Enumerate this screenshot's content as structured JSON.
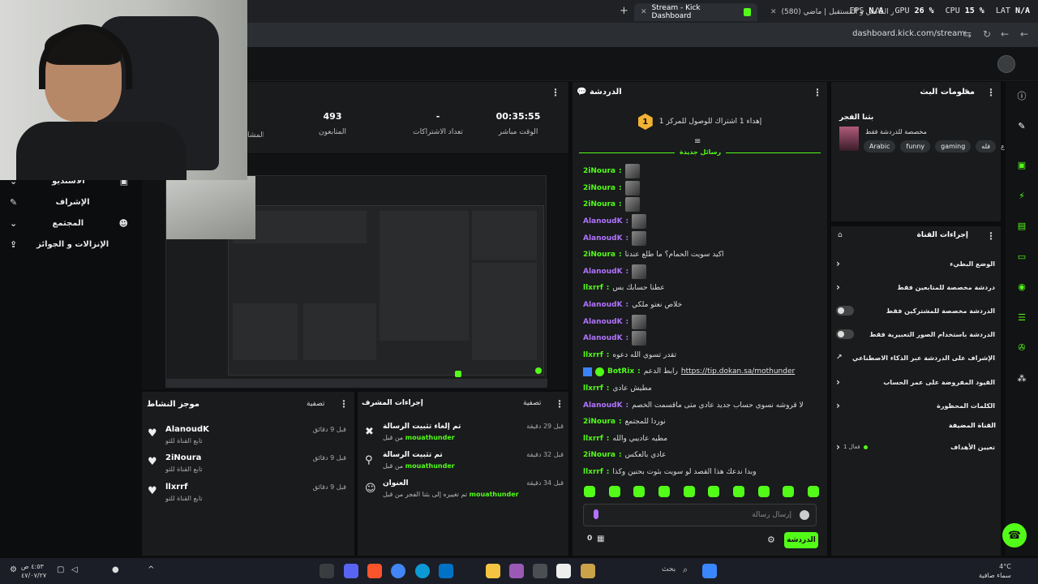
{
  "browser": {
    "tabs": [
      {
        "label": "Stream - Kick Dashboard",
        "active": true
      },
      {
        "label": "(580) ناور الماضي و المستقبل | ماضي",
        "active": false
      }
    ],
    "url": "dashboard.kick.com/stream",
    "perf": {
      "fps_label": "FPS",
      "fps": "N/A",
      "gpu_label": "GPU",
      "gpu": "26 %",
      "cpu_label": "CPU",
      "cpu": "15 %",
      "lat_label": "LAT",
      "lat": "N/A"
    }
  },
  "left_nav": [
    {
      "label": "الاستديو",
      "icon": "studio-icon"
    },
    {
      "label": "الإشراف",
      "icon": "wrench-icon"
    },
    {
      "label": "المجتمع",
      "icon": "community-icon"
    },
    {
      "label": "الإنزالات و الجوائز",
      "icon": "drops-icon"
    }
  ],
  "stats": {
    "live_time": {
      "value": "00:35:55",
      "label": "الوقت مباشر"
    },
    "subs": {
      "value": "-",
      "label": "تعداد الاشتراكات"
    },
    "viewers": {
      "value": "493",
      "label": "المتابعون"
    },
    "partial_label": "المشا"
  },
  "activity": {
    "title": "موجز النشاط",
    "filter": "تصفية",
    "items": [
      {
        "name": "AlanoudK",
        "sub": "تابع القناة للتو",
        "time": "قبل 9 دقائق"
      },
      {
        "name": "2iNoura",
        "sub": "تابع القناة للتو",
        "time": "قبل 9 دقائق"
      },
      {
        "name": "llxrrf",
        "sub": "تابع القناة للتو",
        "time": "قبل 9 دقائق"
      }
    ]
  },
  "mod_actions": {
    "title": "إجراءات المشرف",
    "filter": "تصفية",
    "items": [
      {
        "title": "تم إلغاء تثبيت الرسالة",
        "by_prefix": "من قبل",
        "user": "mouathunder",
        "time": "قبل 29 دقيقة"
      },
      {
        "title": "تم تثبيت الرسالة",
        "by_prefix": "من قبل",
        "user": "mouathunder",
        "time": "قبل 32 دقيقة"
      },
      {
        "title": "العنوان",
        "by_prefix": "تم تغييره إلى بثنا الفجر من قبل",
        "user": "mouathunder",
        "time": "قبل 34 دقيقة"
      }
    ]
  },
  "chat": {
    "title": "الدردشة",
    "goal_text": "إهداء 1 اشتراك للوصول للمركز 1",
    "goal_rank": "1",
    "new_messages": "رسائل جديدة",
    "colors": {
      "green": "#53fc18",
      "purple": "#b072ff"
    },
    "messages": [
      {
        "user": "2iNoura",
        "color": "#53fc18",
        "text": "",
        "emotes": 1
      },
      {
        "user": "2iNoura",
        "color": "#53fc18",
        "text": "",
        "emotes": 1
      },
      {
        "user": "2iNoura",
        "color": "#53fc18",
        "text": "",
        "emotes": 1
      },
      {
        "user": "AlanoudK",
        "color": "#b072ff",
        "text": "",
        "emotes": 1
      },
      {
        "user": "AlanoudK",
        "color": "#b072ff",
        "text": "",
        "emotes": 1
      },
      {
        "user": "2iNoura",
        "color": "#53fc18",
        "text": "اكيد سويت الحمام؟ ما طلع عندنا",
        "emotes": 0
      },
      {
        "user": "AlanoudK",
        "color": "#b072ff",
        "text": "",
        "emotes": 1
      },
      {
        "user": "llxrrf",
        "color": "#53fc18",
        "text": "عطنا حسابك بس",
        "emotes": 0
      },
      {
        "user": "AlanoudK",
        "color": "#b072ff",
        "text": "خلاص نعتو ملكي",
        "emotes": 0
      },
      {
        "user": "AlanoudK",
        "color": "#b072ff",
        "text": "",
        "emotes": 1
      },
      {
        "user": "AlanoudK",
        "color": "#b072ff",
        "text": "",
        "emotes": 1
      },
      {
        "user": "llxrrf",
        "color": "#53fc18",
        "text": "تقدر تسوي الله دعوه",
        "emotes": 0
      },
      {
        "user": "BotRix",
        "color": "#53fc18",
        "text": "رابط الدعم",
        "link": "https://tip.dokan.sa/mothunder",
        "bot": true
      },
      {
        "user": "llxrrf",
        "color": "#53fc18",
        "text": "مطيش عادي",
        "emotes": 0
      },
      {
        "user": "AlanoudK",
        "color": "#b072ff",
        "text": "لا قروشه نسوي حساب جديد عادي متى ماقسمت الخصم",
        "emotes": 0
      },
      {
        "user": "2iNoura",
        "color": "#53fc18",
        "text": "نوردا للمجتمع",
        "emotes": 0
      },
      {
        "user": "llxrrf",
        "color": "#53fc18",
        "text": "مطيه عاديبي والله",
        "emotes": 0
      },
      {
        "user": "2iNoura",
        "color": "#53fc18",
        "text": "عادي بالعكس",
        "emotes": 0
      },
      {
        "user": "llxrrf",
        "color": "#53fc18",
        "text": "وبدا ندعك هذا القصد لو سويت بثوت بحنين وكذا",
        "emotes": 0
      }
    ],
    "input_placeholder": "إرسال رسالة",
    "send_button": "الدردشة",
    "count": "0"
  },
  "stream_info": {
    "title": "معلومات البث",
    "stream_name": "بثنا الفجر",
    "category": "مخصصة للدردشة فقط",
    "tags": [
      "Arabic",
      "funny",
      "gaming",
      "فله"
    ],
    "extra_tag": "ع"
  },
  "channel_actions": {
    "title": "إجراءات القناة",
    "rows": [
      {
        "label": "الوضع البطيء",
        "control": "chevron"
      },
      {
        "label": "دردشة مخصصة للمتابعين فقط",
        "control": "chevron"
      },
      {
        "label": "الدردشة مخصصة للمشتركين فقط",
        "control": "toggle"
      },
      {
        "label": "الدردشة باستخدام الصور التعبيرية فقط",
        "control": "toggle"
      },
      {
        "label": "الإشراف على الدردشة عبر الذكاء الاصطناعي",
        "control": "external"
      },
      {
        "label": "القيود المفروضة على عمر الحساب",
        "control": "chevron"
      },
      {
        "label": "الكلمات المحظورة",
        "control": "chevron"
      }
    ],
    "pinned_section": "القناة المضيفة",
    "goals_label": "تعيين الأهداف",
    "goals_status": "فعال 1"
  },
  "taskbar": {
    "search": "بحث",
    "clock_time": "٤:٥٣ ص",
    "clock_date": "٤٧/٠٧/٢٧",
    "temp": "4°C",
    "weather": "سماء صافية"
  }
}
